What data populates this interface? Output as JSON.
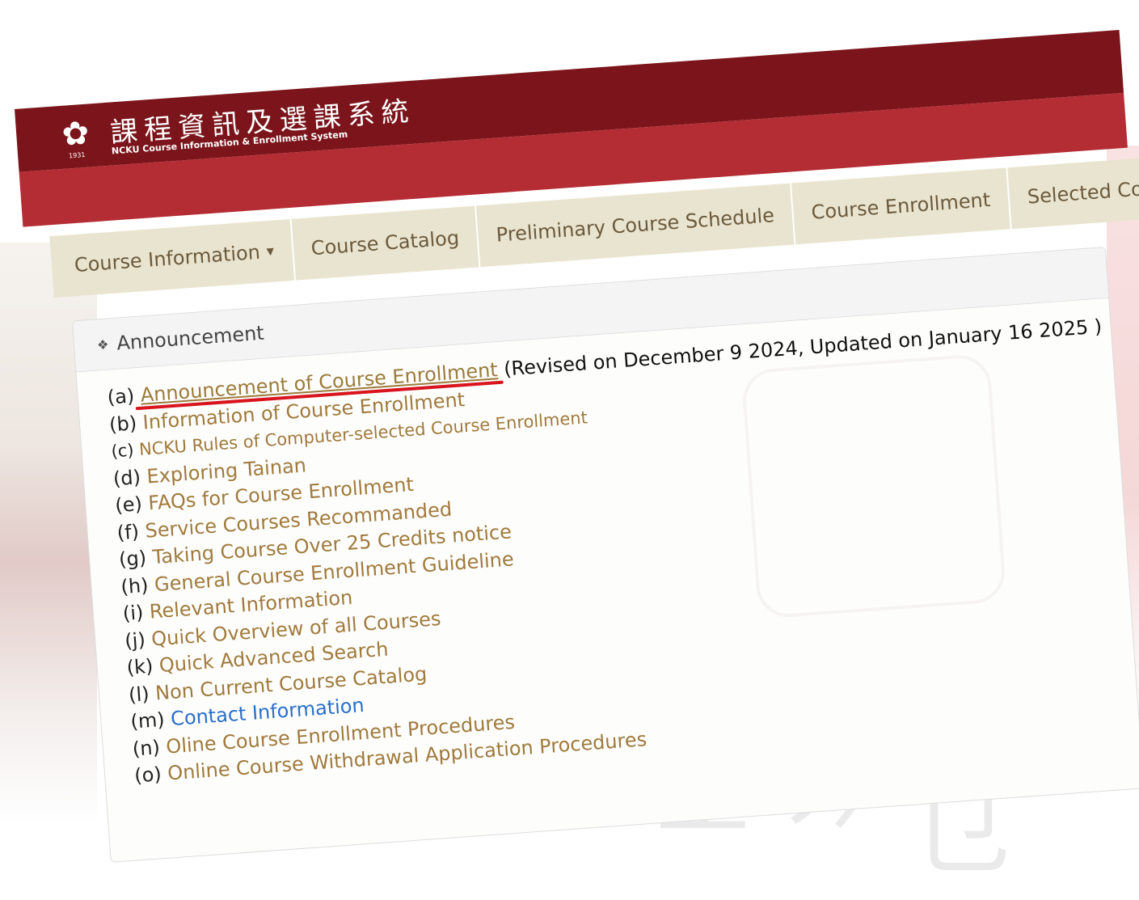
{
  "header": {
    "title_cn": "課程資訊及選課系統",
    "title_en": "NCKU Course Information & Enrollment System",
    "logo_year": "1931"
  },
  "nav": {
    "items": [
      {
        "label": "Course Information",
        "dropdown": true
      },
      {
        "label": "Course Catalog"
      },
      {
        "label": "Preliminary Course Schedule"
      },
      {
        "label": "Course Enrollment"
      },
      {
        "label": "Selected Courses",
        "dropdown": true
      }
    ]
  },
  "panel": {
    "title": "Announcement",
    "first_note": "(Revised on December 9 2024, Updated on January 16  2025 )",
    "items": [
      {
        "prefix": "(a)",
        "label": "Announcement of Course Enrollment"
      },
      {
        "prefix": "(b)",
        "label": "Information of Course Enrollment"
      },
      {
        "prefix": "(c)",
        "label": "NCKU Rules of Computer-selected Course Enrollment"
      },
      {
        "prefix": "(d)",
        "label": "Exploring Tainan"
      },
      {
        "prefix": "(e)",
        "label": "FAQs for Course Enrollment"
      },
      {
        "prefix": "(f)",
        "label": "Service Courses Recommanded"
      },
      {
        "prefix": "(g)",
        "label": "Taking Course Over 25 Credits notice"
      },
      {
        "prefix": "(h)",
        "label": "General Course Enrollment Guideline"
      },
      {
        "prefix": "(i)",
        "label": "Relevant Information"
      },
      {
        "prefix": "(j)",
        "label": "Quick Overview of all Courses"
      },
      {
        "prefix": "(k)",
        "label": "Quick Advanced Search"
      },
      {
        "prefix": "(l)",
        "label": "Non Current Course Catalog"
      },
      {
        "prefix": "(m)",
        "label": "Contact Information"
      },
      {
        "prefix": "(n)",
        "label": "Oline Course Enrollment Procedures"
      },
      {
        "prefix": "(o)",
        "label": "Online Course Withdrawal Application Procedures"
      }
    ]
  },
  "colors": {
    "header_dark": "#7b151b",
    "header_red": "#b42d34",
    "nav_bg": "#e9e4cf",
    "link": "#a07a3c",
    "link_blue": "#2a6fc9",
    "highlight": "#d8141e"
  }
}
